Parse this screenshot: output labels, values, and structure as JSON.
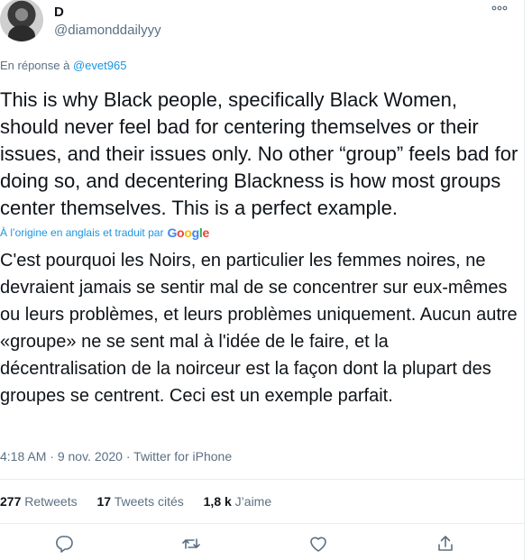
{
  "author": {
    "name": "D",
    "handle": "@diamonddailyyy",
    "more_icon": "more-dots-icon"
  },
  "reply": {
    "prefix": "En réponse à",
    "mention": "@evet965"
  },
  "tweet": {
    "text": "This is why Black people, specifically Black Women, should never feel bad for centering themselves or their issues, and their issues only. No other “group” feels bad for doing so, and decentering Blackness is how most groups center themselves. This is a perfect example."
  },
  "translation": {
    "note": "À l’origine en anglais et traduit par",
    "provider": [
      "G",
      "o",
      "o",
      "g",
      "l",
      "e"
    ],
    "text": "C'est pourquoi les Noirs, en particulier les femmes noires, ne devraient jamais se sentir mal de se concentrer sur eux-mêmes ou leurs problèmes, et leurs problèmes uniquement. Aucun autre «groupe» ne se sent mal à l'idée de le faire, et la décentralisation de la noirceur est la façon dont la plupart des groupes se centrent. Ceci est un exemple parfait."
  },
  "meta": {
    "time": "4:18 AM",
    "sep1": " · ",
    "date": "9 nov. 2020",
    "sep2": " · ",
    "source": "Twitter for iPhone"
  },
  "stats": {
    "retweets_count": "277",
    "retweets_label": "Retweets",
    "quotes_count": "17",
    "quotes_label": "Tweets cités",
    "likes_count": "1,8 k",
    "likes_label": "J’aime"
  },
  "actions": [
    "reply-icon",
    "retweet-icon",
    "like-icon",
    "share-icon"
  ],
  "colors": {
    "link": "#1b95e0",
    "muted": "#5b7083",
    "text": "#0f1419",
    "divider": "#e6ecf0"
  }
}
